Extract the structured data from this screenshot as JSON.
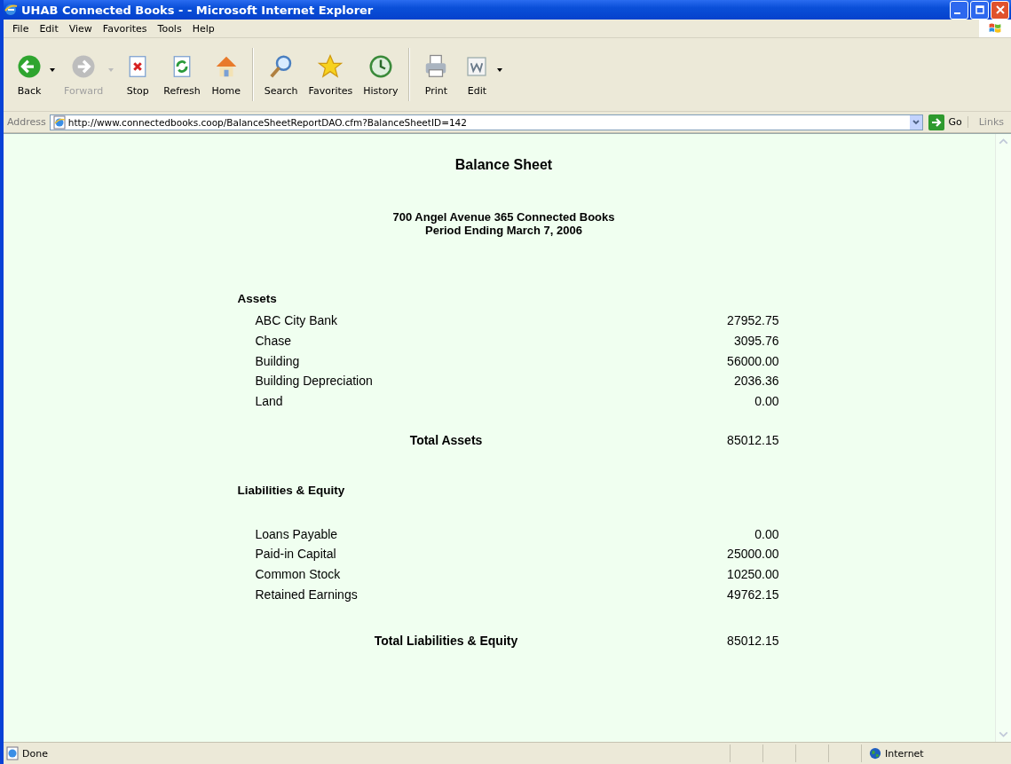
{
  "window": {
    "title": "UHAB Connected Books - - Microsoft Internet Explorer"
  },
  "menu": [
    "File",
    "Edit",
    "View",
    "Favorites",
    "Tools",
    "Help"
  ],
  "toolbar_groups": [
    [
      {
        "label": "Back",
        "kind": "back",
        "disabled": false,
        "dropdown": true
      },
      {
        "label": "Forward",
        "kind": "forward",
        "disabled": true,
        "dropdown": true
      },
      {
        "label": "Stop",
        "kind": "stop",
        "disabled": false,
        "dropdown": false
      },
      {
        "label": "Refresh",
        "kind": "refresh",
        "disabled": false,
        "dropdown": false
      },
      {
        "label": "Home",
        "kind": "home",
        "disabled": false,
        "dropdown": false
      }
    ],
    [
      {
        "label": "Search",
        "kind": "search",
        "disabled": false,
        "dropdown": false
      },
      {
        "label": "Favorites",
        "kind": "favorites",
        "disabled": false,
        "dropdown": false
      },
      {
        "label": "History",
        "kind": "history",
        "disabled": false,
        "dropdown": false
      }
    ],
    [
      {
        "label": "Print",
        "kind": "print",
        "disabled": false,
        "dropdown": false
      },
      {
        "label": "Edit",
        "kind": "edit",
        "disabled": false,
        "dropdown": true
      }
    ]
  ],
  "address": {
    "label": "Address",
    "value": "http://www.connectedbooks.coop/BalanceSheetReportDAO.cfm?BalanceSheetID=142",
    "go": "Go",
    "links": "Links"
  },
  "report": {
    "title": "Balance Sheet",
    "subtitle_lines": [
      "700 Angel Avenue 365 Connected Books",
      "Period Ending March 7, 2006"
    ],
    "sections": [
      {
        "heading": "Assets",
        "rows": [
          {
            "name": "ABC City Bank",
            "amount": "27952.75"
          },
          {
            "name": "Chase",
            "amount": "3095.76"
          },
          {
            "name": "Building",
            "amount": "56000.00"
          },
          {
            "name": "Building Depreciation",
            "amount": "2036.36"
          },
          {
            "name": "Land",
            "amount": "0.00"
          }
        ],
        "total": {
          "label": "Total Assets",
          "amount": "85012.15"
        }
      },
      {
        "heading": "Liabilities & Equity",
        "rows": [
          {
            "name": "Loans Payable",
            "amount": "0.00"
          },
          {
            "name": "Paid-in Capital",
            "amount": "25000.00"
          },
          {
            "name": "Common Stock",
            "amount": "10250.00"
          },
          {
            "name": "Retained Earnings",
            "amount": "49762.15"
          }
        ],
        "total": {
          "label": "Total Liabilities & Equity",
          "amount": "85012.15"
        }
      }
    ]
  },
  "status_bar": {
    "text": "Done",
    "zone": "Internet"
  }
}
